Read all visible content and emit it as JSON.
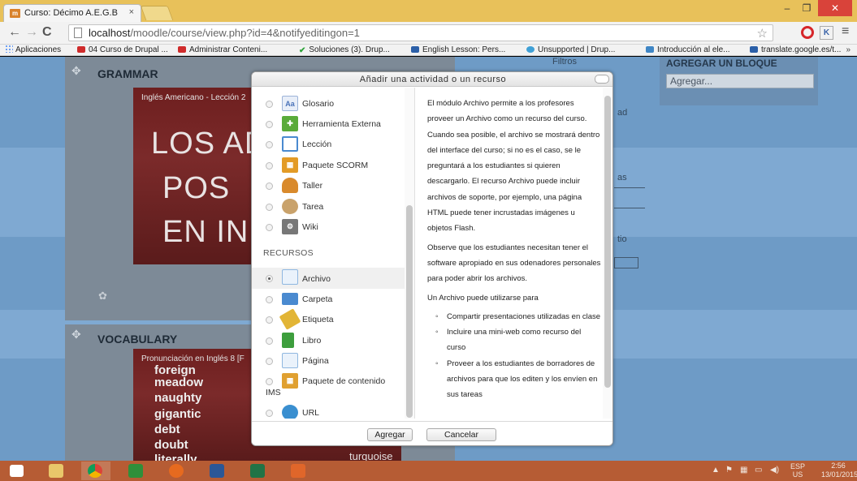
{
  "browser": {
    "tab_title": "Curso: Décimo A.E.G.B",
    "tab_close": "×",
    "url_host": "localhost",
    "url_path": "/moodle/course/view.php?id=4&notifyeditingon=1",
    "bookmarks": [
      "Aplicaciones",
      "04 Curso de Drupal ...",
      "Administrar Conteni...",
      "Soluciones (3). Drup...",
      "English Lesson: Pers...",
      "Unsupported | Drup...",
      "Introducción al ele...",
      "translate.google.es/t..."
    ],
    "bookmarks_more": "»"
  },
  "page": {
    "sections": [
      {
        "title": "GRAMMAR",
        "video_caption": "Inglés Americano - Lección 2",
        "video_lines": [
          "LOS AD",
          "POS",
          "EN IN"
        ]
      },
      {
        "title": "VOCABULARY",
        "video_caption": "Pronunciación en Inglés 8 [F",
        "video_words": [
          "foreign",
          "meadow",
          "naughty",
          "gigantic",
          "debt",
          "doubt",
          "literally"
        ]
      }
    ],
    "block_title": "AGREGAR UN BLOQUE",
    "block_select": "Agregar...",
    "bg_fragments": [
      "Filtros",
      "ad",
      "as",
      "tio",
      "turquoise"
    ]
  },
  "modal": {
    "title": "Añadir una actividad o un recurso",
    "activities": [
      {
        "label": "Glosario",
        "icon": "glossary-icon",
        "color": "#5b8fd6"
      },
      {
        "label": "Herramienta Externa",
        "icon": "puzzle-icon",
        "color": "#5aab3a"
      },
      {
        "label": "Lección",
        "icon": "lesson-icon",
        "color": "#4a8ad0"
      },
      {
        "label": "Paquete SCORM",
        "icon": "scorm-icon",
        "color": "#e39b26"
      },
      {
        "label": "Taller",
        "icon": "workshop-icon",
        "color": "#d98a2c"
      },
      {
        "label": "Tarea",
        "icon": "assignment-icon",
        "color": "#c9a26b"
      },
      {
        "label": "Wiki",
        "icon": "wiki-icon",
        "color": "#777777"
      }
    ],
    "resources_heading": "RECURSOS",
    "resources": [
      {
        "label": "Archivo",
        "icon": "file-icon",
        "color": "#8fb7e0",
        "selected": true
      },
      {
        "label": "Carpeta",
        "icon": "folder-icon",
        "color": "#4a8ad0"
      },
      {
        "label": "Etiqueta",
        "icon": "label-icon",
        "color": "#e2b536"
      },
      {
        "label": "Libro",
        "icon": "book-icon",
        "color": "#3d9e3d"
      },
      {
        "label": "Página",
        "icon": "page-icon",
        "color": "#8fb7e0"
      },
      {
        "label": "Paquete de contenido",
        "icon": "package-icon",
        "color": "#e0a030"
      },
      {
        "label": "URL",
        "icon": "url-icon",
        "color": "#3a8fd0"
      }
    ],
    "ims_text": "IMS",
    "help": {
      "p1": "El módulo Archivo permite a los profesores proveer un Archivo como un recurso del curso. Cuando sea posible, el archivo se mostrará dentro del interface del curso; si no es el caso, se le preguntará a los estudiantes si quieren descargarlo. El recurso Archivo puede incluir archivos de soporte, por ejemplo, una página HTML puede tener incrustadas imágenes u objetos Flash.",
      "p2": "Observe que los estudiantes necesitan tener el software apropiado en sus odenadores personales para poder abrir los archivos.",
      "p3": "Un Archivo puede utilizarse para",
      "items": [
        "Compartir presentaciones utilizadas en clase",
        "Incluire una mini-web como recurso del curso",
        "Proveer a los estudiantes de borradores de archivos para que los editen y los envíen en sus tareas"
      ]
    },
    "add_label": "Agregar",
    "cancel_label": "Cancelar"
  },
  "taskbar": {
    "apps": [
      "start-icon",
      "explorer-icon",
      "chrome-icon",
      "store-icon",
      "firefox-icon",
      "word-icon",
      "excel-icon",
      "xampp-icon"
    ],
    "lang": "ESP",
    "lang_sub": "US",
    "time": "2:56",
    "date": "13/01/2015",
    "colors": {
      "taskbar": "#b65c34",
      "page_bg": "#6e9bc6",
      "tab_strip": "#e8c15a"
    }
  }
}
